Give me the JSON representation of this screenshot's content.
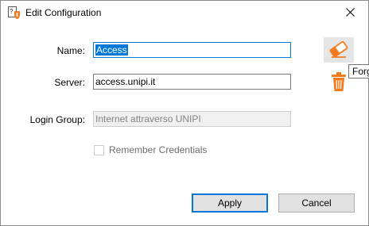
{
  "window": {
    "title": "Edit Configuration"
  },
  "form": {
    "name_label": "Name:",
    "name_value": "Access",
    "server_label": "Server:",
    "server_value": "access.unipi.it",
    "login_group_label": "Login Group:",
    "login_group_value": "Internet attraverso UNIPI",
    "remember_label": "Remember Credentials",
    "remember_checked": false
  },
  "tools": {
    "forget_tooltip": "Forg"
  },
  "buttons": {
    "apply": "Apply",
    "cancel": "Cancel"
  },
  "icons": {
    "app": "key-shield-icon",
    "eraser": "eraser-icon",
    "trash": "trash-icon",
    "close": "close-icon"
  },
  "colors": {
    "accent": "#0078d7",
    "icon_orange": "#f47a20"
  }
}
